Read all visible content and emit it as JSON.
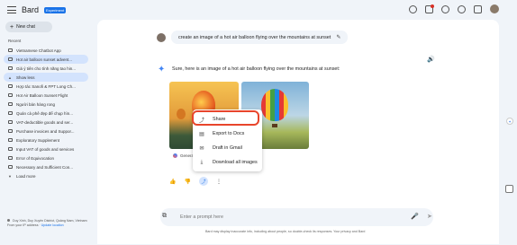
{
  "app": {
    "name": "Bard",
    "badge": "Experiment"
  },
  "sidebar": {
    "new_chat": "New chat",
    "recent_label": "Recent",
    "items": [
      {
        "label": "Vietnamese Chatbot App",
        "active": false
      },
      {
        "label": "Hot air balloon sunset advent...",
        "active": true
      },
      {
        "label": "Giá ý tiên cho tính năng tao hin...",
        "active": false
      }
    ],
    "show_less": "Show less",
    "more_items": [
      {
        "label": "Hợp tác Sanofi & FPT Long Ch..."
      },
      {
        "label": "Hot Air Balloon Sunset Flight"
      },
      {
        "label": "Người bán hàng rong"
      },
      {
        "label": "Quán cà phê đẹp để chụp hìn..."
      },
      {
        "label": "VAT-deductible goods and ser..."
      },
      {
        "label": "Purchase invoices and Suppor..."
      },
      {
        "label": "Exploratory Supplement"
      },
      {
        "label": "Input VAT of goods and services"
      },
      {
        "label": "Error of Equivocation"
      },
      {
        "label": "Necessary and Sufficient Con..."
      }
    ],
    "load_more": "Load more",
    "location_line1": "Duy Xinh, Duy Xuyên District, Quảng Nam, Vietnam",
    "location_from": "From your IP address",
    "location_link": "Update location"
  },
  "chat": {
    "prompt": "create an image of a hot air balloon flying over the mountains at sunset",
    "response": "Sure, here is an image of a hot air balloon flying over the mountains at sunset:",
    "generated_label": "Generated"
  },
  "menu": {
    "items": [
      "Share",
      "Export to Docs",
      "Draft in Gmail",
      "Download all images"
    ]
  },
  "input": {
    "placeholder": "Enter a prompt here"
  },
  "disclaimer": "Bard may display inaccurate info, including about people, so double-check its responses. Your privacy and Bard"
}
